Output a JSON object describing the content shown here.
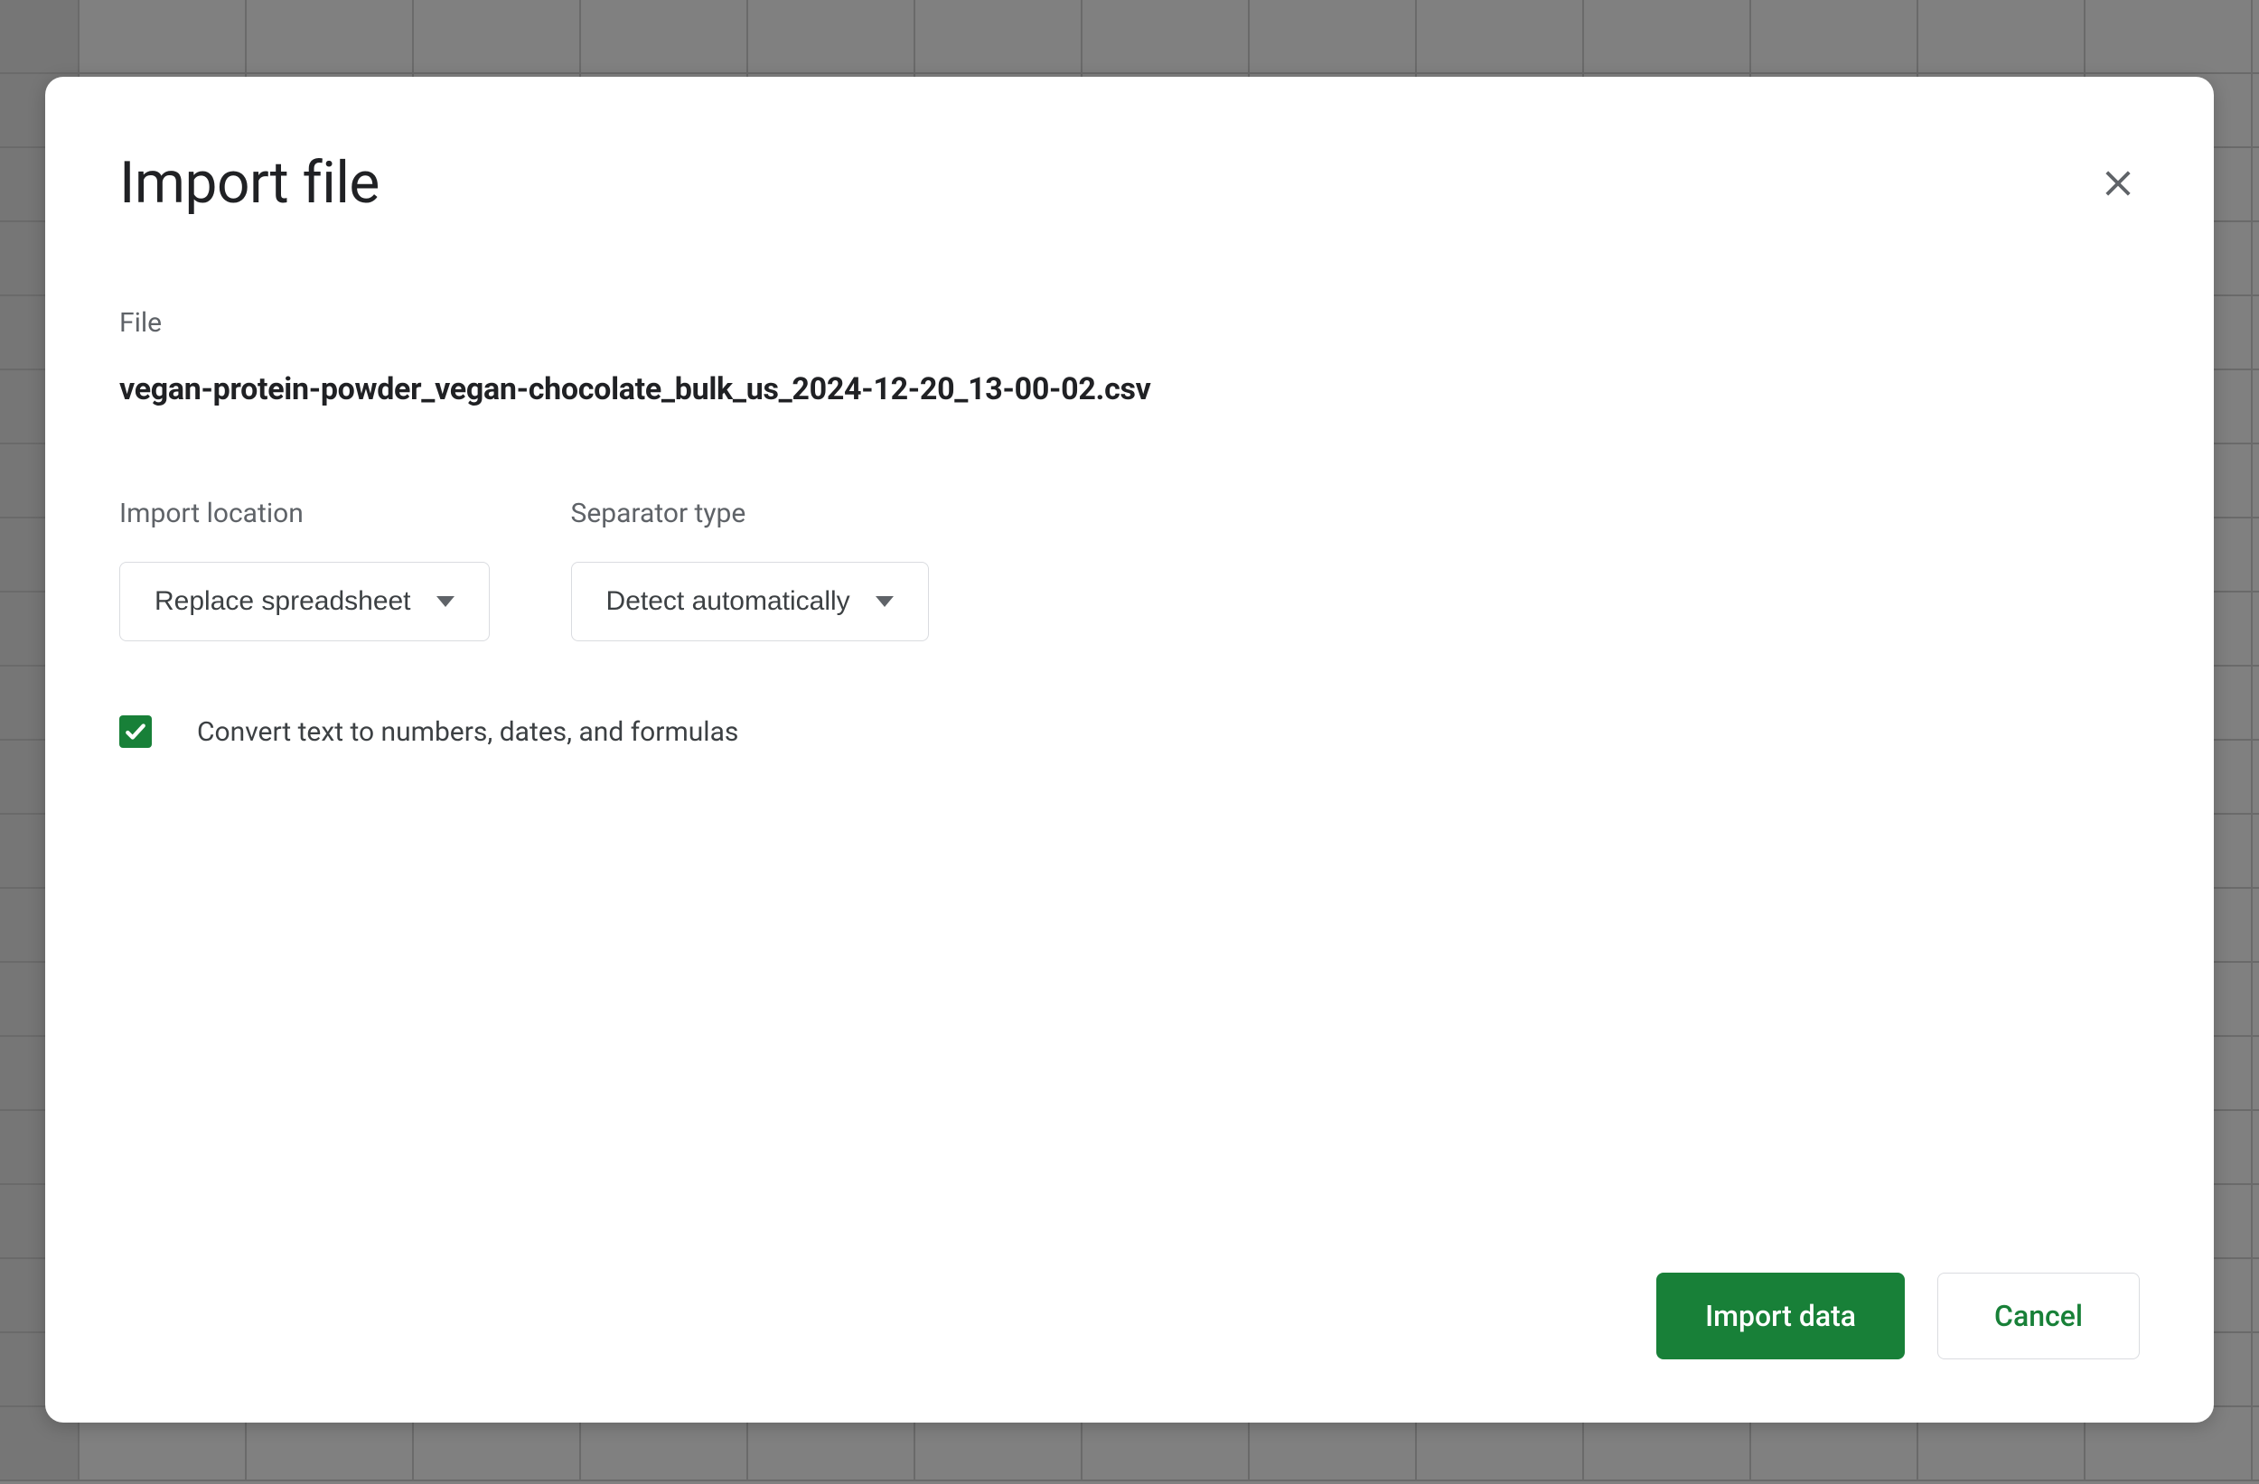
{
  "dialog": {
    "title": "Import file",
    "file_label": "File",
    "file_name": "vegan-protein-powder_vegan-chocolate_bulk_us_2024-12-20_13-00-02.csv",
    "import_location": {
      "label": "Import location",
      "selected": "Replace spreadsheet"
    },
    "separator_type": {
      "label": "Separator type",
      "selected": "Detect automatically"
    },
    "convert_checkbox": {
      "checked": true,
      "label": "Convert text to numbers, dates, and formulas"
    },
    "actions": {
      "primary": "Import data",
      "secondary": "Cancel"
    }
  }
}
